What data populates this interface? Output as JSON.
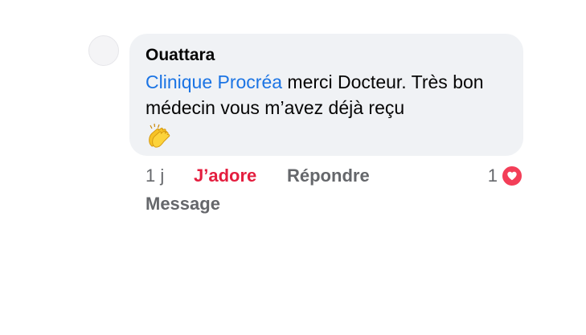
{
  "comment": {
    "author": "Ouattara",
    "mention": "Clinique Procréa",
    "text": " merci Docteur. Très bon médecin vous m’avez déjà reçu",
    "emoji": "clapping-hands-icon"
  },
  "actions": {
    "time": "1 j",
    "like_label": "J’adore",
    "reply_label": "Répondre",
    "message_label": "Message",
    "reaction_count": "1",
    "reaction_icon": "heart-icon"
  },
  "colors": {
    "bubble": "#f0f2f5",
    "mention": "#1b74e4",
    "like_active": "#e41e3f",
    "secondary_text": "#65676b",
    "heart": "#f33e58"
  }
}
